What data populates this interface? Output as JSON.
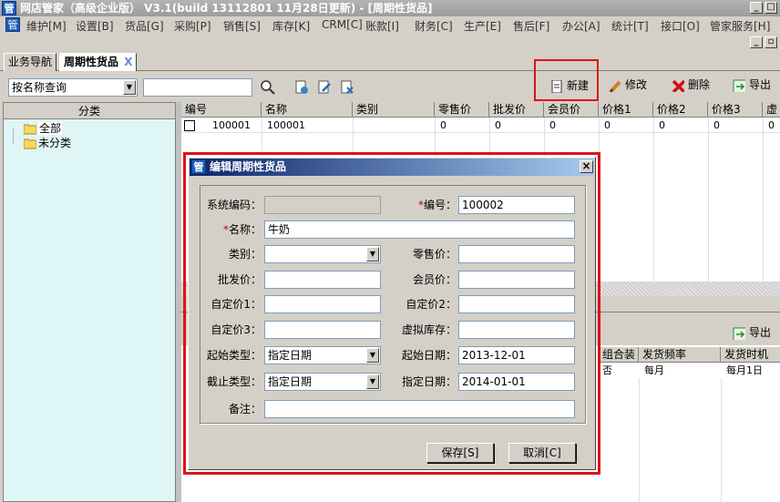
{
  "window": {
    "title": "网店管家（高级企业版） V3.1(build 13112801 11月28日更新) - [周期性货品]",
    "icon_label": "管"
  },
  "menu": [
    "维护[M]",
    "设置[B]",
    "货品[G]",
    "采购[P]",
    "销售[S]",
    "库存[K]",
    "CRM[C]",
    "账款[I]",
    "财务[C]",
    "生产[E]",
    "售后[F]",
    "办公[A]",
    "统计[T]",
    "接口[O]",
    "管家服务[H]"
  ],
  "tabs": {
    "nav": "业务导航",
    "active": "周期性货品",
    "close": "X"
  },
  "search": {
    "mode": "按名称查询",
    "value": ""
  },
  "toolbar": {
    "new": "新建",
    "edit": "修改",
    "delete": "删除",
    "export": "导出"
  },
  "category": {
    "header": "分类",
    "items": [
      "全部",
      "未分类"
    ]
  },
  "grid": {
    "headers": [
      "编号",
      "名称",
      "类别",
      "零售价",
      "批发价",
      "会员价",
      "价格1",
      "价格2",
      "价格3",
      "虚"
    ],
    "rows": [
      [
        "100001",
        "100001",
        "",
        "0",
        "0",
        "0",
        "0",
        "0",
        "0",
        "0"
      ]
    ]
  },
  "lower_grid": {
    "export": "导出",
    "headers": [
      "组合装",
      "发货频率",
      "发货时机"
    ],
    "rows": [
      [
        "否",
        "每月",
        "每月1日"
      ]
    ]
  },
  "dialog": {
    "title": "编辑周期性货品",
    "close": "×",
    "labels": {
      "sys_code": "系统编码：",
      "code": "编号：",
      "name": "名称：",
      "category": "类别：",
      "retail": "零售价：",
      "wholesale": "批发价：",
      "member": "会员价：",
      "custom1": "自定价1：",
      "custom2": "自定价2：",
      "custom3": "自定价3：",
      "virtual_stock": "虚拟库存：",
      "start_type": "起始类型：",
      "start_date": "起始日期：",
      "end_type": "截止类型：",
      "end_date": "指定日期：",
      "note": "备注："
    },
    "values": {
      "sys_code": "",
      "code": "100002",
      "name": "牛奶",
      "category": "",
      "retail": "",
      "wholesale": "",
      "member": "",
      "custom1": "",
      "custom2": "",
      "custom3": "",
      "virtual_stock": "",
      "start_type": "指定日期",
      "start_date": "2013-12-01",
      "end_type": "指定日期",
      "end_date": "2014-01-01",
      "note": ""
    },
    "required_mark": "*",
    "save": "保存[S]",
    "cancel": "取消[C]"
  },
  "colors": {
    "highlight": "#e0101a",
    "dialog_title": "#0a246a",
    "panel": "#dff6f6"
  }
}
